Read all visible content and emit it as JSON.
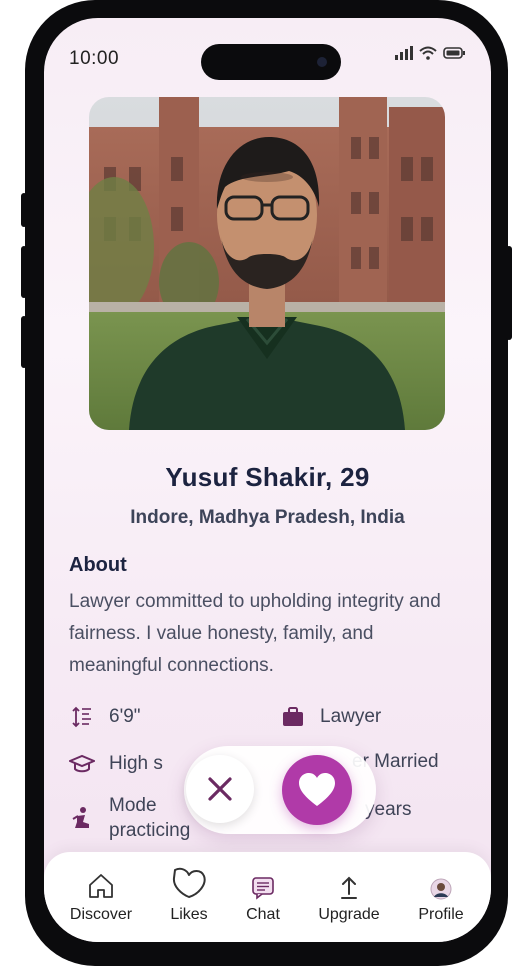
{
  "status": {
    "time": "10:00"
  },
  "profile": {
    "name": "Yusuf Shakir, 29",
    "location": "Indore, Madhya Pradesh, India",
    "about_heading": "About",
    "about_text": "Lawyer committed to upholding integrity and fairness. I value honesty, family, and meaningful connections.",
    "height": "6'9\"",
    "profession": "Lawyer",
    "education": "High s",
    "marital_status": "er Married",
    "religiosity_line1": "Mode",
    "religiosity_line2": "practicing",
    "years_text": "years"
  },
  "nav": {
    "items": [
      {
        "label": "Discover",
        "icon": "home-icon"
      },
      {
        "label": "Likes",
        "icon": "heart-outline-icon"
      },
      {
        "label": "Chat",
        "icon": "chat-icon"
      },
      {
        "label": "Upgrade",
        "icon": "upload-arrow-icon"
      },
      {
        "label": "Profile",
        "icon": "avatar-icon"
      }
    ]
  },
  "colors": {
    "accent": "#b03aa8",
    "heading": "#1c2340",
    "icon": "#6b2a62"
  }
}
